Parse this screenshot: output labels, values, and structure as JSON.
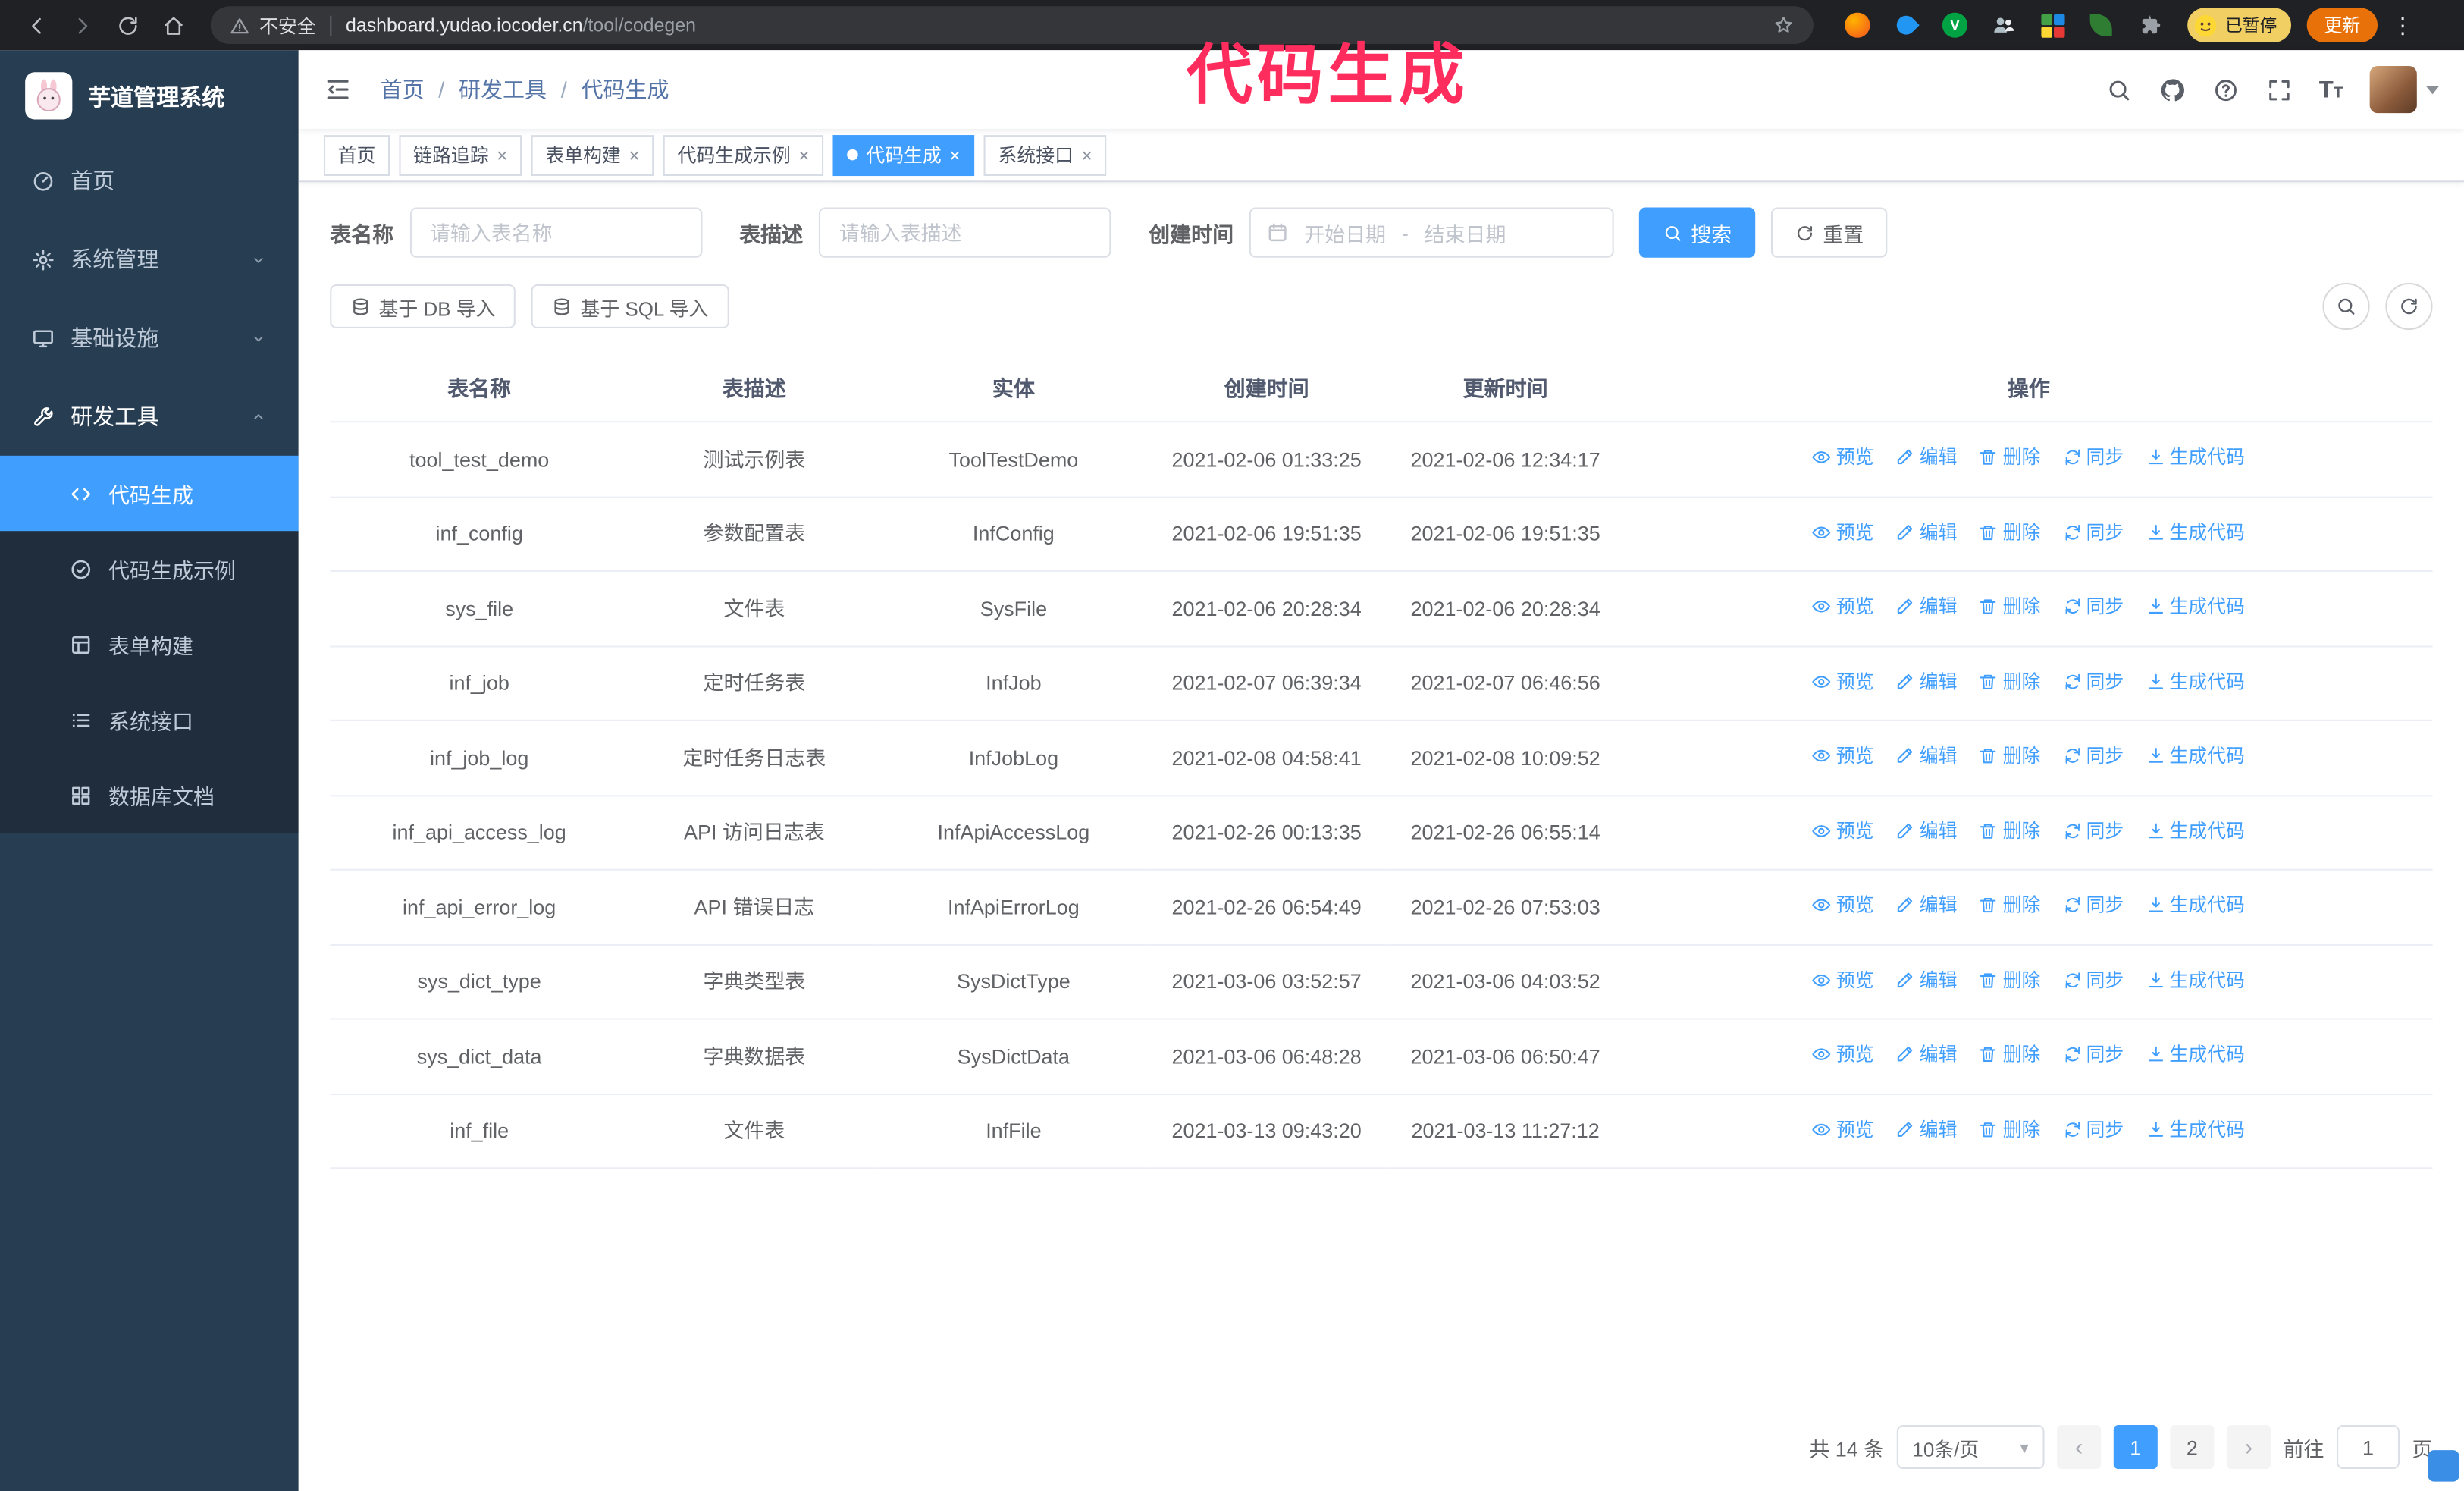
{
  "browser": {
    "security_label": "不安全",
    "url_host": "dashboard.yudao.iocoder.cn",
    "url_path": "/tool/codegen",
    "paused_badge": "已暂停",
    "update_button": "更新"
  },
  "annotation": {
    "text": "代码生成"
  },
  "sidebar": {
    "logo_title": "芋道管理系统",
    "items": [
      {
        "label": "首页"
      },
      {
        "label": "系统管理",
        "expandable": true
      },
      {
        "label": "基础设施",
        "expandable": true
      },
      {
        "label": "研发工具",
        "expanded": true
      }
    ],
    "submenu": [
      {
        "label": "代码生成",
        "active": true
      },
      {
        "label": "代码生成示例"
      },
      {
        "label": "表单构建"
      },
      {
        "label": "系统接口"
      },
      {
        "label": "数据库文档"
      }
    ]
  },
  "topbar": {
    "breadcrumb": [
      "首页",
      "研发工具",
      "代码生成"
    ],
    "breadcrumb_separator": "/"
  },
  "tabs": [
    {
      "label": "首页",
      "closable": false,
      "active": false
    },
    {
      "label": "链路追踪",
      "closable": true,
      "active": false
    },
    {
      "label": "表单构建",
      "closable": true,
      "active": false
    },
    {
      "label": "代码生成示例",
      "closable": true,
      "active": false
    },
    {
      "label": "代码生成",
      "closable": true,
      "active": true
    },
    {
      "label": "系统接口",
      "closable": true,
      "active": false
    }
  ],
  "filters": {
    "table_name_label": "表名称",
    "table_name_placeholder": "请输入表名称",
    "table_desc_label": "表描述",
    "table_desc_placeholder": "请输入表描述",
    "create_time_label": "创建时间",
    "date_start_placeholder": "开始日期",
    "date_separator": "-",
    "date_end_placeholder": "结束日期",
    "search_button": "搜索",
    "reset_button": "重置"
  },
  "toolbar": {
    "import_db_button": "基于 DB 导入",
    "import_sql_button": "基于 SQL 导入"
  },
  "table": {
    "columns": [
      "表名称",
      "表描述",
      "实体",
      "创建时间",
      "更新时间",
      "操作"
    ],
    "actions": [
      "预览",
      "编辑",
      "删除",
      "同步",
      "生成代码"
    ],
    "rows": [
      {
        "name": "tool_test_demo",
        "desc": "测试示例表",
        "entity": "ToolTestDemo",
        "created": "2021-02-06 01:33:25",
        "updated": "2021-02-06 12:34:17"
      },
      {
        "name": "inf_config",
        "desc": "参数配置表",
        "entity": "InfConfig",
        "created": "2021-02-06 19:51:35",
        "updated": "2021-02-06 19:51:35"
      },
      {
        "name": "sys_file",
        "desc": "文件表",
        "entity": "SysFile",
        "created": "2021-02-06 20:28:34",
        "updated": "2021-02-06 20:28:34"
      },
      {
        "name": "inf_job",
        "desc": "定时任务表",
        "entity": "InfJob",
        "created": "2021-02-07 06:39:34",
        "updated": "2021-02-07 06:46:56"
      },
      {
        "name": "inf_job_log",
        "desc": "定时任务日志表",
        "entity": "InfJobLog",
        "created": "2021-02-08 04:58:41",
        "updated": "2021-02-08 10:09:52"
      },
      {
        "name": "inf_api_access_log",
        "desc": "API 访问日志表",
        "entity": "InfApiAccessLog",
        "created": "2021-02-26 00:13:35",
        "updated": "2021-02-26 06:55:14"
      },
      {
        "name": "inf_api_error_log",
        "desc": "API 错误日志",
        "entity": "InfApiErrorLog",
        "created": "2021-02-26 06:54:49",
        "updated": "2021-02-26 07:53:03"
      },
      {
        "name": "sys_dict_type",
        "desc": "字典类型表",
        "entity": "SysDictType",
        "created": "2021-03-06 03:52:57",
        "updated": "2021-03-06 04:03:52"
      },
      {
        "name": "sys_dict_data",
        "desc": "字典数据表",
        "entity": "SysDictData",
        "created": "2021-03-06 06:48:28",
        "updated": "2021-03-06 06:50:47"
      },
      {
        "name": "inf_file",
        "desc": "文件表",
        "entity": "InfFile",
        "created": "2021-03-13 09:43:20",
        "updated": "2021-03-13 11:27:12"
      }
    ]
  },
  "pagination": {
    "total_text": "共 14 条",
    "page_size": "10条/页",
    "pages": [
      "1",
      "2"
    ],
    "active_page": "1",
    "goto_label": "前往",
    "goto_value": "1",
    "goto_suffix": "页"
  },
  "colors": {
    "accent": "#409eff",
    "sidebar_bg": "#273d52",
    "submenu_bg": "#1f2d3d",
    "annotation": "#ff2d5e",
    "update_button_bg": "#e8710a",
    "paused_badge_bg": "#f1cf63"
  }
}
